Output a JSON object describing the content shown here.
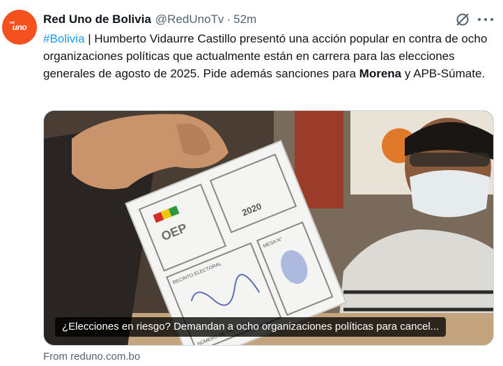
{
  "tweet": {
    "avatar_text": "uno",
    "avatar_small": "red",
    "author_name": "Red Uno de Bolivia",
    "handle": "@RedUnoTv",
    "separator": "·",
    "time": "52m",
    "hashtag": "#Bolivia",
    "text_part1": " | Humberto Vidaurre Castillo presentó una acción popular en contra de ocho organizaciones políticas que actualmente están en carrera para las elecciones generales de agosto de 2025. Pide además sanciones para ",
    "bold1": "Morena",
    "text_part2": " y APB-Súmate."
  },
  "card": {
    "caption": "¿Elecciones en riesgo? Demandan a ocho organizaciones políticas para cancel...",
    "source": "From reduno.com.bo",
    "ballot_brand": "OEP",
    "ballot_year": "2020",
    "ballot_field1": "RECINTO ELECTORAL",
    "ballot_field2": "MESA N°",
    "ballot_field3": "NÚMERO DE PAPELETA"
  },
  "colors": {
    "accent": "#1d9bf0",
    "avatar_bg": "#f4511e",
    "muted": "#536471"
  }
}
